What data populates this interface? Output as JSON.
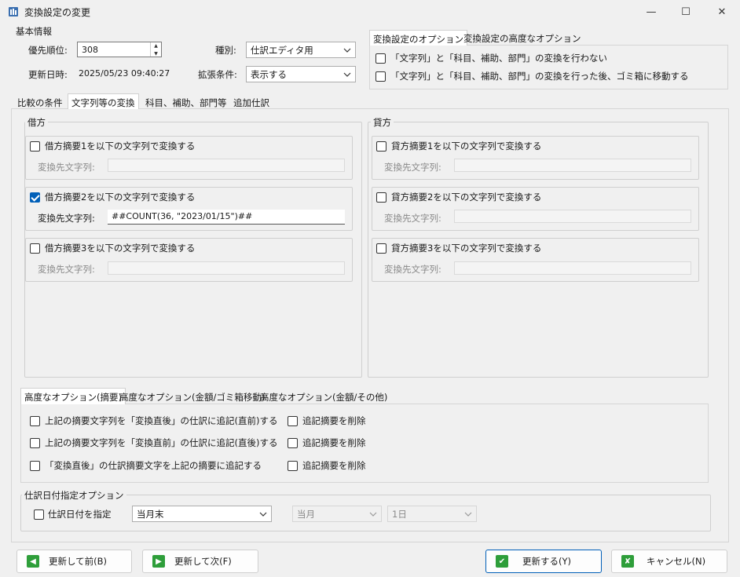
{
  "window": {
    "title": "変換設定の変更",
    "minimize": "—",
    "maximize": "☐",
    "close": "✕"
  },
  "basic": {
    "group_title": "基本情報",
    "priority_label": "優先順位:",
    "priority_value": "308",
    "updated_label": "更新日時:",
    "updated_value": "2025/05/23 09:40:27",
    "type_label": "種別:",
    "type_value": "仕訳エディタ用",
    "ext_label": "拡張条件:",
    "ext_value": "表示する"
  },
  "options_tabs": {
    "tabs": [
      "変換設定のオプション",
      "変換設定の高度なオプション"
    ],
    "items": [
      "「文字列」と「科目、補助、部門」の変換を行わない",
      "「文字列」と「科目、補助、部門」の変換を行った後、ゴミ箱に移動する"
    ]
  },
  "main_tabs": [
    "比較の条件",
    "文字列等の変換",
    "科目、補助、部門等",
    "追加仕訳"
  ],
  "debit": {
    "title": "借方",
    "rows": [
      {
        "label": "借方摘要1を以下の文字列で変換する",
        "checked": false,
        "field_label": "変換先文字列:",
        "value": ""
      },
      {
        "label": "借方摘要2を以下の文字列で変換する",
        "checked": true,
        "field_label": "変換先文字列:",
        "value": "##COUNT(36, \"2023/01/15\")##"
      },
      {
        "label": "借方摘要3を以下の文字列で変換する",
        "checked": false,
        "field_label": "変換先文字列:",
        "value": ""
      }
    ]
  },
  "credit": {
    "title": "貸方",
    "rows": [
      {
        "label": "貸方摘要1を以下の文字列で変換する",
        "checked": false,
        "field_label": "変換先文字列:",
        "value": ""
      },
      {
        "label": "貸方摘要2を以下の文字列で変換する",
        "checked": false,
        "field_label": "変換先文字列:",
        "value": ""
      },
      {
        "label": "貸方摘要3を以下の文字列で変換する",
        "checked": false,
        "field_label": "変換先文字列:",
        "value": ""
      }
    ]
  },
  "advanced": {
    "tabs": [
      "高度なオプション(摘要)",
      "高度なオプション(金額/ゴミ箱移動)",
      "高度なオプション(金額/その他)"
    ],
    "left": [
      "上記の摘要文字列を「変換直後」の仕訳に追記(直前)する",
      "上記の摘要文字列を「変換直前」の仕訳に追記(直後)する",
      "「変換直後」の仕訳摘要文字を上記の摘要に追記する"
    ],
    "right": [
      "追記摘要を削除",
      "追記摘要を削除",
      "追記摘要を削除"
    ]
  },
  "date_opt": {
    "title": "仕訳日付指定オプション",
    "checkbox_label": "仕訳日付を指定",
    "select1": "当月末",
    "select2": "当月",
    "select3": "1日"
  },
  "buttons": {
    "prev": "更新して前(B)",
    "next": "更新して次(F)",
    "update": "更新する(Y)",
    "cancel": "キャンセル(N)"
  },
  "colors": {
    "accent": "#005fb8",
    "green_icon": "#2e9e3a",
    "cancel_icon": "#2e9e3a"
  }
}
